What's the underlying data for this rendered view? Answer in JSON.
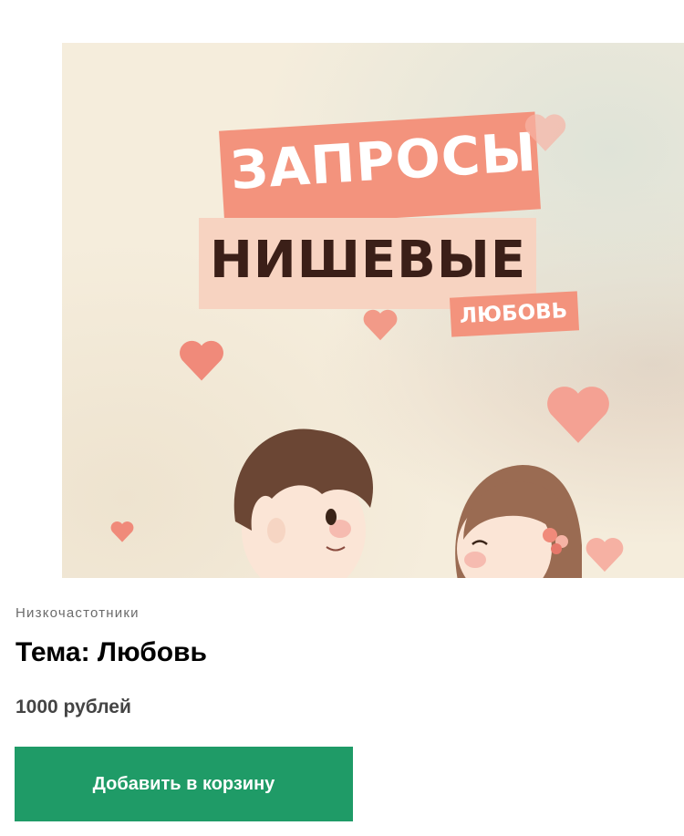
{
  "product": {
    "image": {
      "line1": "ЗАПРОСЫ",
      "line2": "НИШЕВЫЕ",
      "line3": "ЛЮБОВЬ"
    },
    "category": "Низкочастотники",
    "title": "Тема: Любовь",
    "price": "1000 рублей",
    "button_label": "Добавить в корзину"
  },
  "colors": {
    "accent": "#1f9b67",
    "coral": "#f3937d",
    "peach": "#f7d3c1",
    "dark_brown": "#3b1f18"
  },
  "icons": [
    "heart-icon"
  ]
}
